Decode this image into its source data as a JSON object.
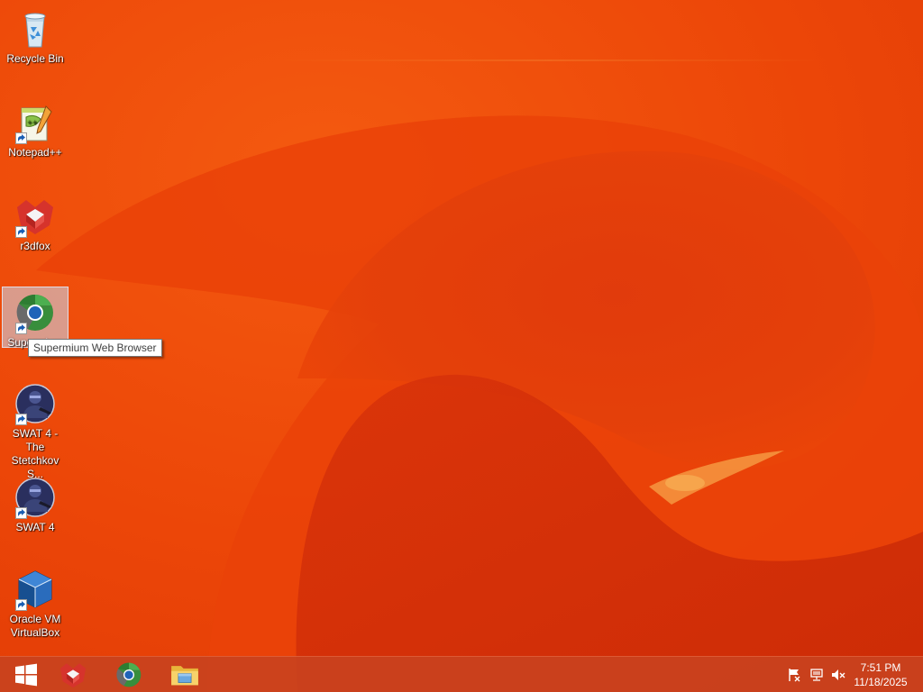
{
  "desktop": {
    "icons": [
      {
        "label": "Recycle Bin",
        "icon": "recycle-bin-icon"
      },
      {
        "label": "Notepad++",
        "icon": "notepad-plus-plus-icon"
      },
      {
        "label": "r3dfox",
        "icon": "r3dfox-icon"
      },
      {
        "label": "Supermium",
        "icon": "supermium-icon"
      },
      {
        "label": "SWAT 4 - The Stetchkov S...",
        "icon": "swat4-stetchkov-icon"
      },
      {
        "label": "SWAT 4",
        "icon": "swat4-icon"
      },
      {
        "label": "Oracle VM VirtualBox",
        "icon": "virtualbox-icon"
      }
    ],
    "tooltip": "Supermium Web Browser"
  },
  "taskbar": {
    "pinned": [
      {
        "name": "r3dfox",
        "icon": "r3dfox-icon"
      },
      {
        "name": "Supermium",
        "icon": "supermium-icon"
      },
      {
        "name": "File Explorer",
        "icon": "file-explorer-icon"
      }
    ],
    "tray": [
      "action-center-flag-icon",
      "network-icon",
      "volume-muted-icon"
    ],
    "clock": {
      "time": "7:51 PM",
      "date": "11/18/2025"
    }
  },
  "colors": {
    "wallpaper_base": "#ee4a0a",
    "wallpaper_deep": "#d42a08",
    "taskbar": "#c9421e"
  }
}
